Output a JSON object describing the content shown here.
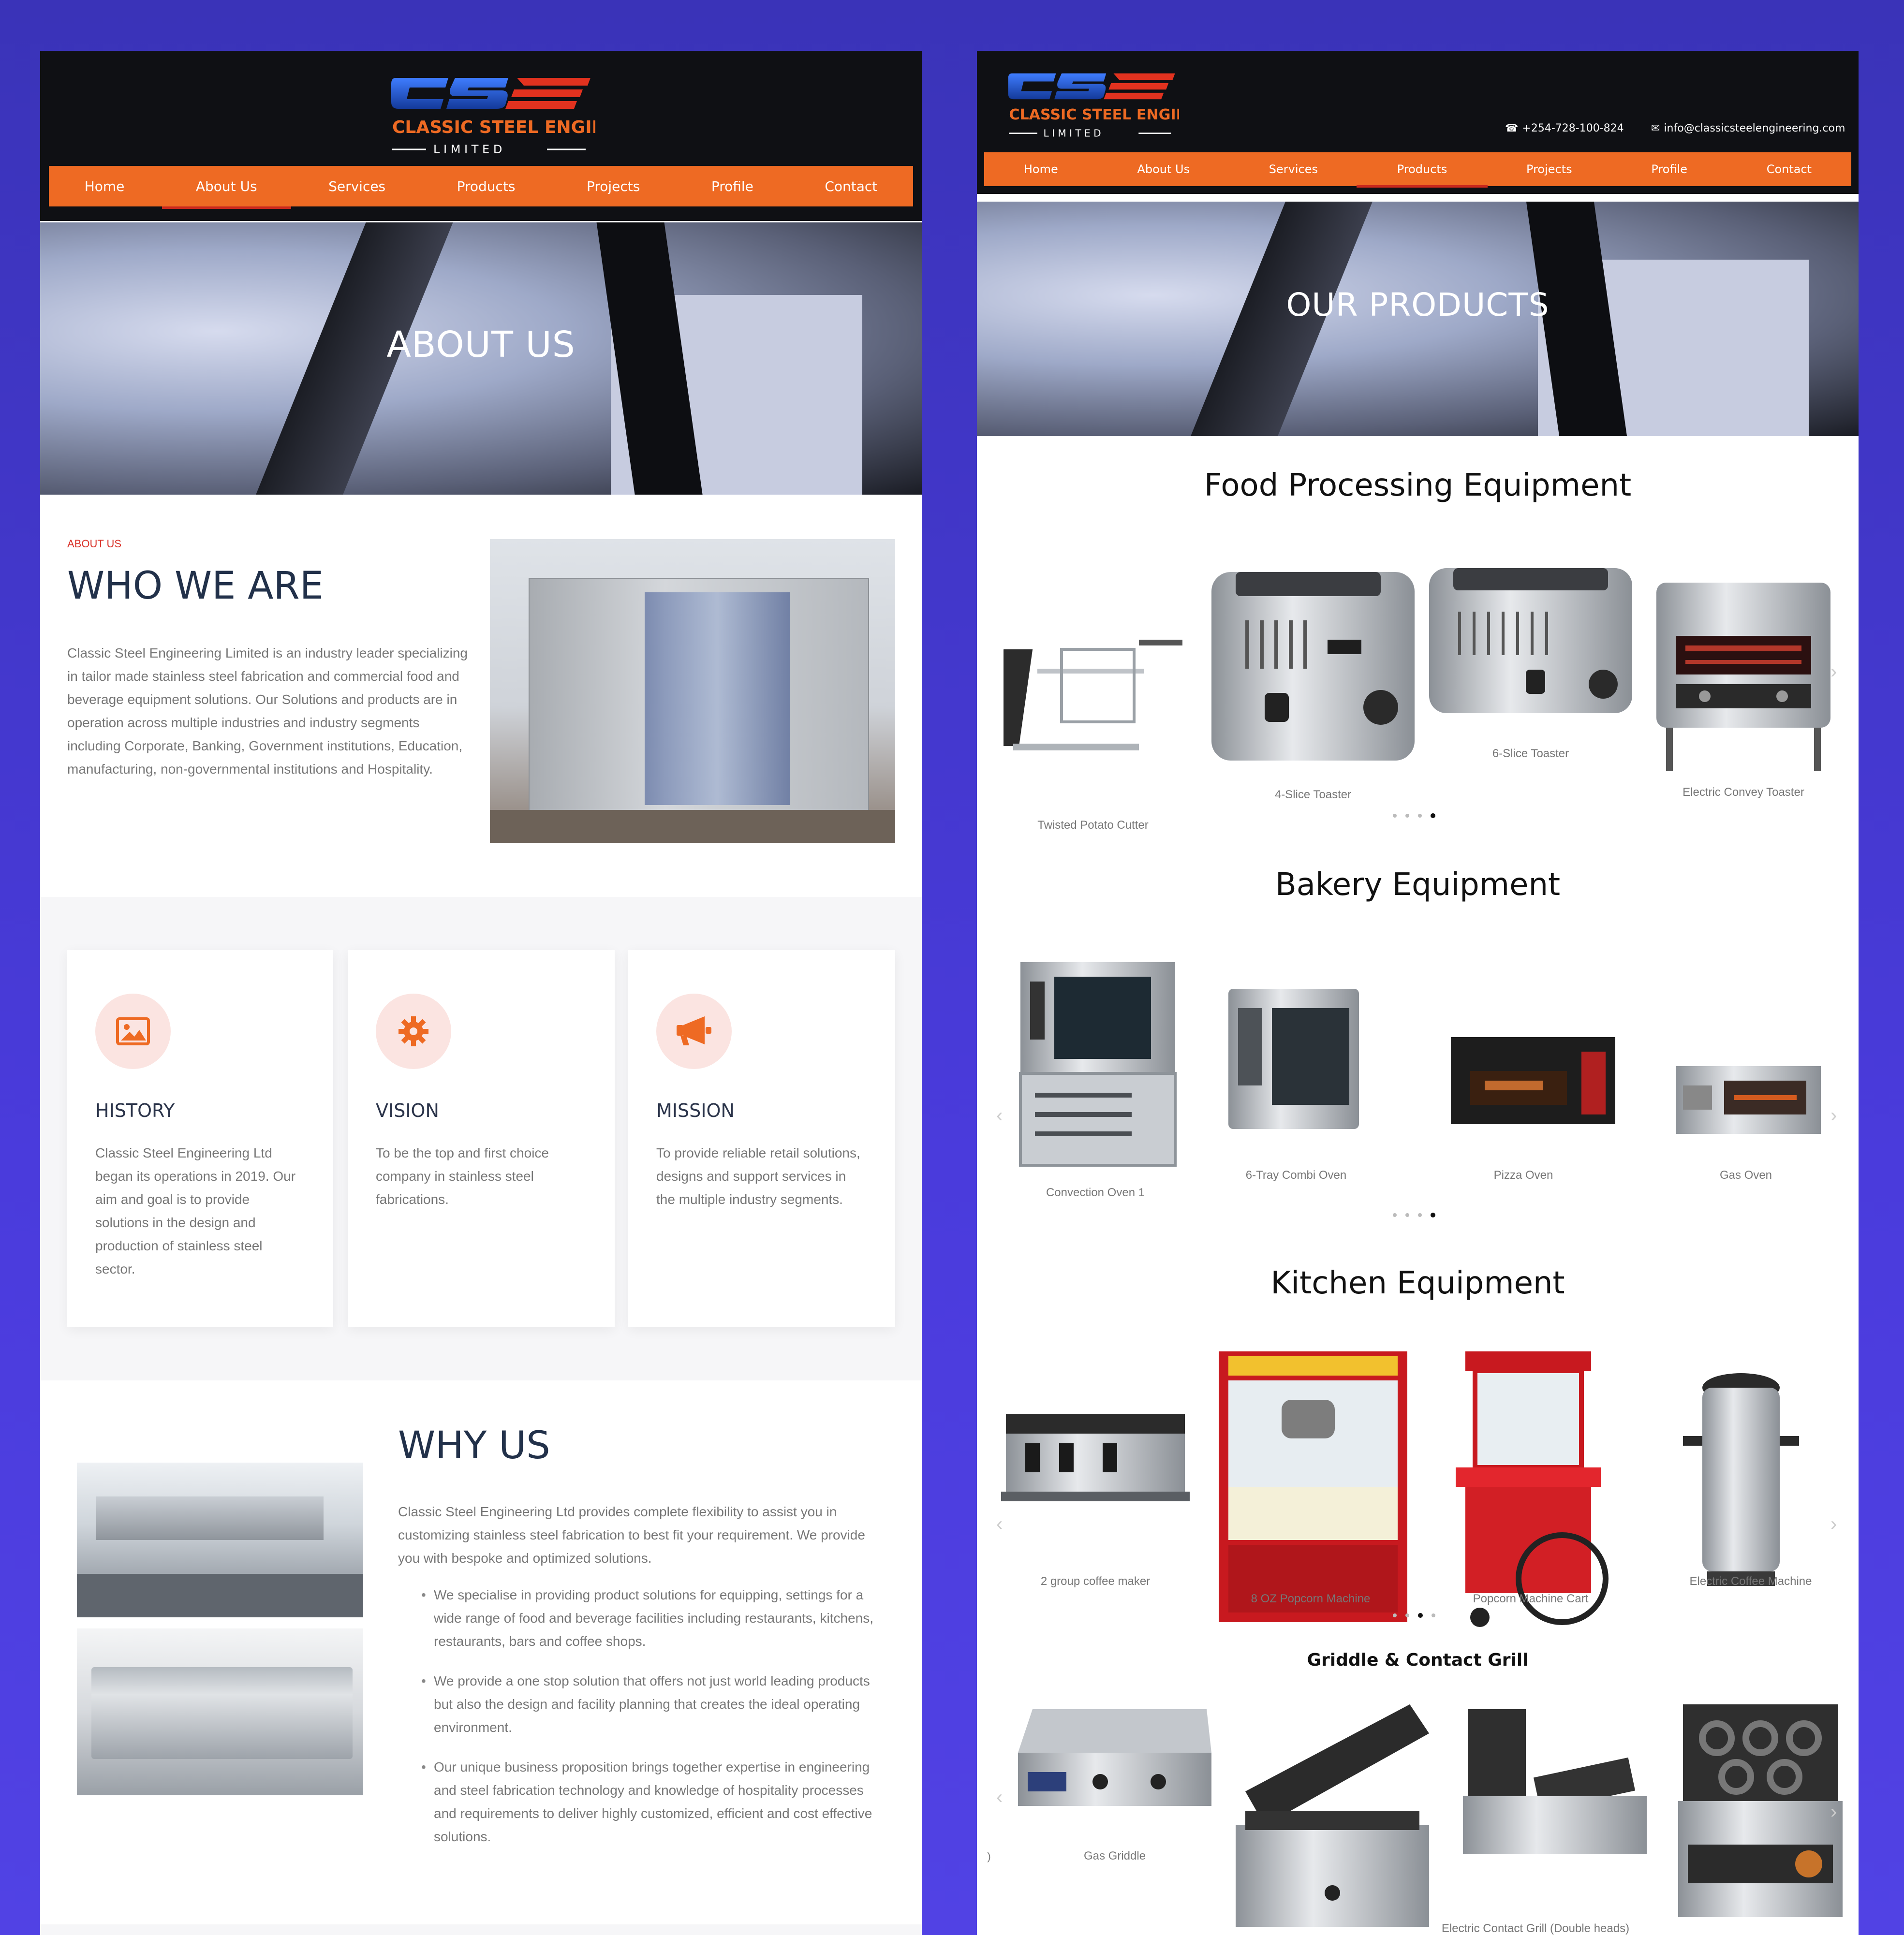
{
  "brand": {
    "name": "CLASSIC STEEL ENGINEERING",
    "sub": "L I M I T E D",
    "colors": {
      "blue": "#1f55c8",
      "orange": "#ee6a23",
      "red": "#e2321f",
      "dark": "#0f1014"
    }
  },
  "left": {
    "nav": [
      "Home",
      "About Us",
      "Services",
      "Products",
      "Projects",
      "Profile",
      "Contact"
    ],
    "nav_active": "About Us",
    "hero_title": "ABOUT US",
    "about": {
      "kicker": "ABOUT US",
      "title": "WHO WE ARE",
      "text": "Classic Steel Engineering Limited is an industry leader specializing in tailor made stainless steel fabrication and commercial food and beverage equipment solutions. Our Solutions and products are in operation across multiple industries and industry segments including Corporate, Banking, Government institutions, Education, manufacturing, non-governmental institutions and Hospitality."
    },
    "cards": [
      {
        "icon": "image-icon",
        "title": "HISTORY",
        "text": "Classic Steel Engineering Ltd began its operations in 2019. Our aim and goal is to provide solutions in the design and production of stainless steel sector."
      },
      {
        "icon": "gear-icon",
        "title": "VISION",
        "text": "To be the top and first choice company in stainless steel fabrications."
      },
      {
        "icon": "megaphone-icon",
        "title": "MISSION",
        "text": "To provide reliable retail solutions, designs and support services in the multiple industry segments."
      }
    ],
    "why": {
      "title": "WHY US",
      "intro": "Classic Steel Engineering Ltd provides complete flexibility to assist you in customizing stainless steel fabrication to best fit your requirement. We provide you with bespoke and optimized solutions.",
      "bullets": [
        "We specialise in providing product solutions for equipping, settings for a wide range of food and beverage facilities including restaurants, kitchens, restaurants, bars and coffee shops.",
        "We provide a one stop solution that offers not just world leading products but also the design and facility planning that creates the ideal operating environment.",
        "Our unique business proposition brings together expertise in engineering and steel fabrication technology and knowledge of hospitality processes and requirements to deliver highly customized, efficient and cost effective solutions."
      ]
    }
  },
  "right": {
    "phone": "+254-728-100-824",
    "email": "info@classicsteelengineering.com",
    "nav": [
      "Home",
      "About Us",
      "Services",
      "Products",
      "Projects",
      "Profile",
      "Contact"
    ],
    "nav_active": "Products",
    "hero_title": "OUR PRODUCTS",
    "sections": [
      {
        "title": "Food Processing Equipment",
        "items": [
          "Twisted Potato Cutter",
          "4-Slice Toaster",
          "6-Slice Toaster",
          "Electric Convey Toaster"
        ]
      },
      {
        "title": "Bakery Equipment",
        "items": [
          "Convection Oven 1",
          "6-Tray Combi Oven",
          "Pizza Oven",
          "Gas Oven"
        ]
      },
      {
        "title": "Kitchen Equipment",
        "items": [
          "2 group coffee maker",
          "8 OZ Popcorn Machine",
          "Popcorn Machine Cart",
          "Electric Coffee Machine"
        ]
      },
      {
        "title": "Griddle & Contact Grill",
        "items": [
          "Gas Griddle",
          "Electric Contact Grill (Double heads)"
        ]
      }
    ],
    "stray_char": ")"
  }
}
